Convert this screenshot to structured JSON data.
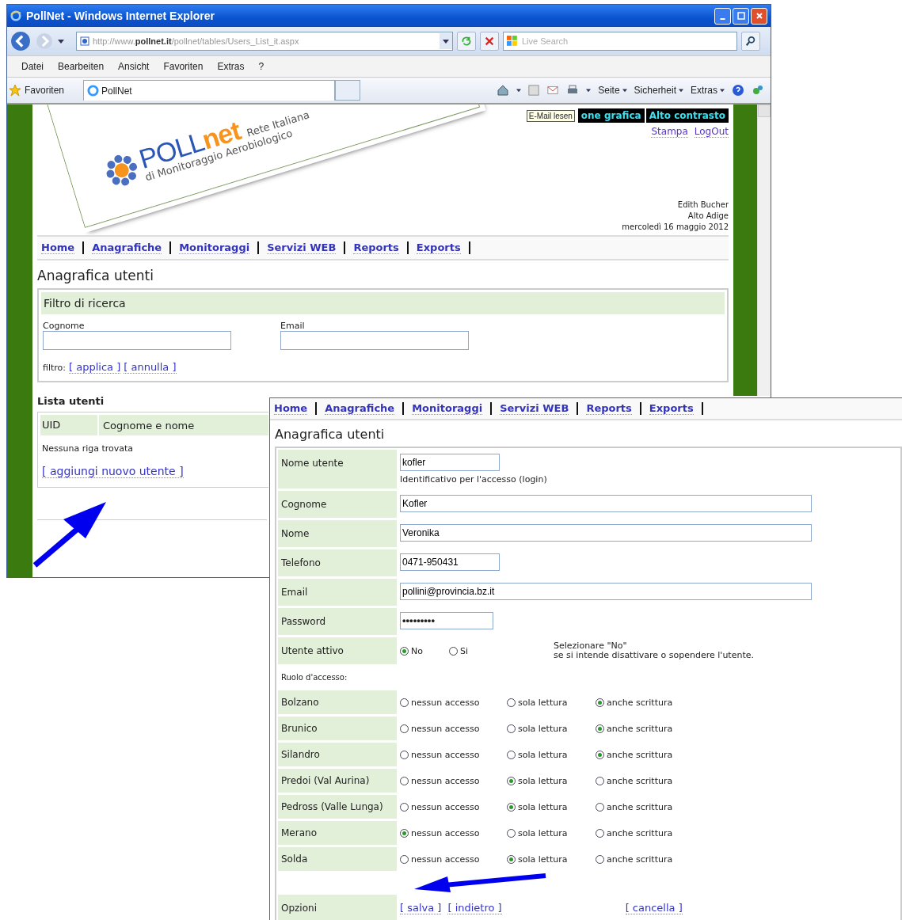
{
  "browser": {
    "title": "PollNet - Windows Internet Explorer",
    "address_a": "http://www.",
    "address_b": "pollnet.it",
    "address_c": "/pollnet/tables/Users_List_it.aspx",
    "search_placeholder": "Live Search",
    "menu": [
      "Datei",
      "Bearbeiten",
      "Ansicht",
      "Favoriten",
      "Extras",
      "?"
    ],
    "favorites": "Favoriten",
    "tab": "PollNet",
    "toolbar": [
      "Seite",
      "Sicherheit",
      "Extras"
    ]
  },
  "header": {
    "brand_a": "POLL",
    "brand_b": "net",
    "tagline_1": "Rete Italiana",
    "tagline_2": "di Monitoraggio Aerobiologico",
    "tooltip": "E-Mail lesen",
    "top_links": [
      "one grafica",
      "Alto contrasto"
    ],
    "links": [
      "Stampa",
      "LogOut"
    ],
    "user": "Edith Bucher",
    "region": "Alto Adige",
    "date": "mercoledì 16 maggio 2012"
  },
  "nav": [
    "Home",
    "Anagrafiche",
    "Monitoraggi",
    "Servizi WEB",
    "Reports",
    "Exports"
  ],
  "list_page": {
    "title": "Anagrafica utenti",
    "filter_title": "Filtro di ricerca",
    "filter_fields": [
      {
        "label": "Cognome"
      },
      {
        "label": "Email"
      }
    ],
    "filter_prefix": "filtro:",
    "filter_actions": [
      "[ applica ]",
      "[ annulla ]"
    ],
    "list_title": "Lista utenti",
    "columns": [
      "UID",
      "Cognome e nome"
    ],
    "empty": "Nessuna riga trovata",
    "add_link": "[ aggiungi nuovo utente ]"
  },
  "edit_page": {
    "nav": [
      "Home",
      "Anagrafiche",
      "Monitoraggi",
      "Servizi WEB",
      "Reports",
      "Exports"
    ],
    "title": "Anagrafica utenti",
    "fields": [
      {
        "label": "Nome utente",
        "value": "kofler",
        "kind": "short",
        "hint": "Identificativo per l'accesso (login)"
      },
      {
        "label": "Cognome",
        "value": "Kofler",
        "kind": "long"
      },
      {
        "label": "Nome",
        "value": "Veronika",
        "kind": "long"
      },
      {
        "label": "Telefono",
        "value": "0471-950431",
        "kind": "short"
      },
      {
        "label": "Email",
        "value": "pollini@provincia.bz.it",
        "kind": "long"
      },
      {
        "label": "Password",
        "value": "•••••••••",
        "kind": "password"
      }
    ],
    "active": {
      "label": "Utente attivo",
      "options": [
        {
          "label": "No",
          "selected": true
        },
        {
          "label": "Si",
          "selected": false
        }
      ],
      "note_1": "Selezionare \"No\"",
      "note_2": "se si intende disattivare o sopendere l'utente."
    },
    "role_title": "Ruolo d'accesso:",
    "stations": [
      {
        "name": "Bolzano",
        "options": [
          {
            "label": "nessun accesso",
            "selected": false
          },
          {
            "label": "sola lettura",
            "selected": false
          },
          {
            "label": "anche scrittura",
            "selected": true
          }
        ]
      },
      {
        "name": "Brunico",
        "options": [
          {
            "label": "nessun accesso",
            "selected": false
          },
          {
            "label": "sola lettura",
            "selected": false
          },
          {
            "label": "anche scrittura",
            "selected": true
          }
        ]
      },
      {
        "name": "Silandro",
        "options": [
          {
            "label": "nessun accesso",
            "selected": false
          },
          {
            "label": "sola lettura",
            "selected": false
          },
          {
            "label": "anche scrittura",
            "selected": true
          }
        ]
      },
      {
        "name": "Predoi (Val Aurina)",
        "options": [
          {
            "label": "nessun accesso",
            "selected": false
          },
          {
            "label": "sola lettura",
            "selected": true
          },
          {
            "label": "anche scrittura",
            "selected": false
          }
        ]
      },
      {
        "name": "Pedross (Valle Lunga)",
        "options": [
          {
            "label": "nessun accesso",
            "selected": false
          },
          {
            "label": "sola lettura",
            "selected": true
          },
          {
            "label": "anche scrittura",
            "selected": false
          }
        ]
      },
      {
        "name": "Merano",
        "options": [
          {
            "label": "nessun accesso",
            "selected": true
          },
          {
            "label": "sola lettura",
            "selected": false
          },
          {
            "label": "anche scrittura",
            "selected": false
          }
        ]
      },
      {
        "name": "Solda",
        "options": [
          {
            "label": "nessun accesso",
            "selected": false
          },
          {
            "label": "sola lettura",
            "selected": true
          },
          {
            "label": "anche scrittura",
            "selected": false
          }
        ]
      }
    ],
    "options_label": "Opzioni",
    "actions": [
      "[ salva ]",
      "[ indietro ]"
    ],
    "cancel": "[ cancella ]"
  }
}
